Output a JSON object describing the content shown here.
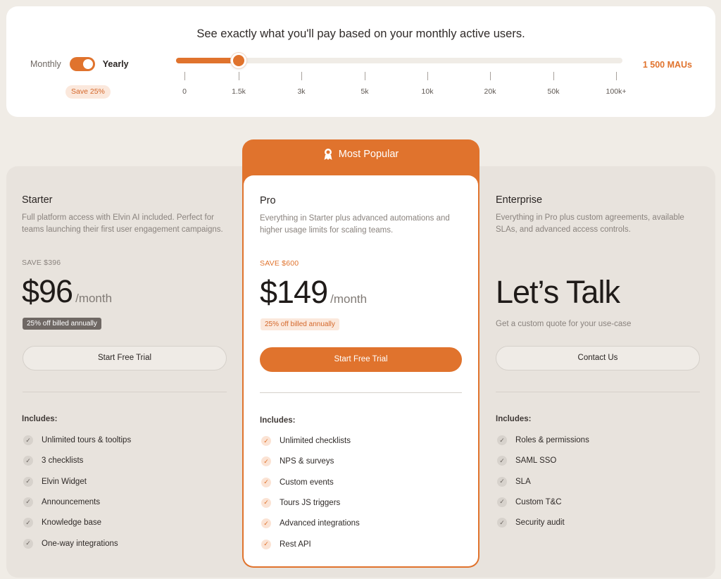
{
  "calculator": {
    "headline": "See exactly what you'll pay based on your monthly active users.",
    "monthly_label": "Monthly",
    "yearly_label": "Yearly",
    "yearly_selected": true,
    "save_badge": "Save 25%",
    "slider_ticks": [
      "0",
      "1.5k",
      "3k",
      "5k",
      "10k",
      "20k",
      "50k",
      "100k+"
    ],
    "slider_selected_index": 1,
    "mau_readout": "1 500 MAUs",
    "accent_color": "#e0732d"
  },
  "starter": {
    "name": "Starter",
    "description_line1": "Full platform access with Elvin AI included. Perfect for",
    "description_line2": "teams launching their first user engagement campaigns.",
    "save": "SAVE $396",
    "price": "$96",
    "per_month": "/month",
    "billed_note": "25% off billed annually",
    "cta": "Start Free Trial",
    "includes_label": "Includes:",
    "features": [
      "Unlimited tours & tooltips",
      "3 checklists",
      "Elvin Widget",
      "Announcements",
      "Knowledge base",
      "One-way integrations"
    ]
  },
  "pro": {
    "badge": "Most Popular",
    "badge_icon": "ribbon-award-icon",
    "name": "Pro",
    "description_line1": "Everything in Starter plus advanced automations and",
    "description_line2": "higher usage limits for scaling teams.",
    "save": "SAVE $600",
    "price": "$149",
    "per_month": "/month",
    "billed_note": "25% off billed annually",
    "cta": "Start Free Trial",
    "includes_label": "Includes:",
    "features": [
      "Unlimited checklists",
      "NPS & surveys",
      "Custom events",
      "Tours JS triggers",
      "Advanced integrations",
      "Rest API"
    ]
  },
  "enterprise": {
    "name": "Enterprise",
    "description_line1": "Everything in Pro plus custom agreements, available",
    "description_line2": "SLAs, and advanced access controls.",
    "price": "Let’s Talk",
    "subtext": "Get a custom quote for your use-case",
    "cta": "Contact Us",
    "includes_label": "Includes:",
    "features": [
      "Roles & permissions",
      "SAML SSO",
      "SLA",
      "Custom T&C",
      "Security audit"
    ]
  }
}
